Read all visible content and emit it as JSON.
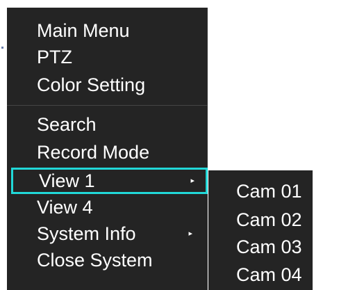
{
  "main_menu": {
    "items": [
      {
        "label": "Main Menu",
        "has_submenu": false
      },
      {
        "label": "PTZ",
        "has_submenu": false
      },
      {
        "label": "Color Setting",
        "has_submenu": false
      },
      {
        "label": "Search",
        "has_submenu": false
      },
      {
        "label": "Record Mode",
        "has_submenu": false
      },
      {
        "label": "View 1",
        "has_submenu": true,
        "selected": true
      },
      {
        "label": "View 4",
        "has_submenu": false
      },
      {
        "label": "System Info",
        "has_submenu": true
      },
      {
        "label": "Close System",
        "has_submenu": false
      }
    ],
    "arrow_glyph": "▸"
  },
  "submenu": {
    "items": [
      {
        "label": "Cam 01"
      },
      {
        "label": "Cam 02"
      },
      {
        "label": "Cam 03"
      },
      {
        "label": "Cam 04"
      }
    ]
  },
  "colors": {
    "menu_background": "#242424",
    "text": "#ffffff",
    "selection_border": "#21d8d8",
    "divider": "#454545"
  }
}
